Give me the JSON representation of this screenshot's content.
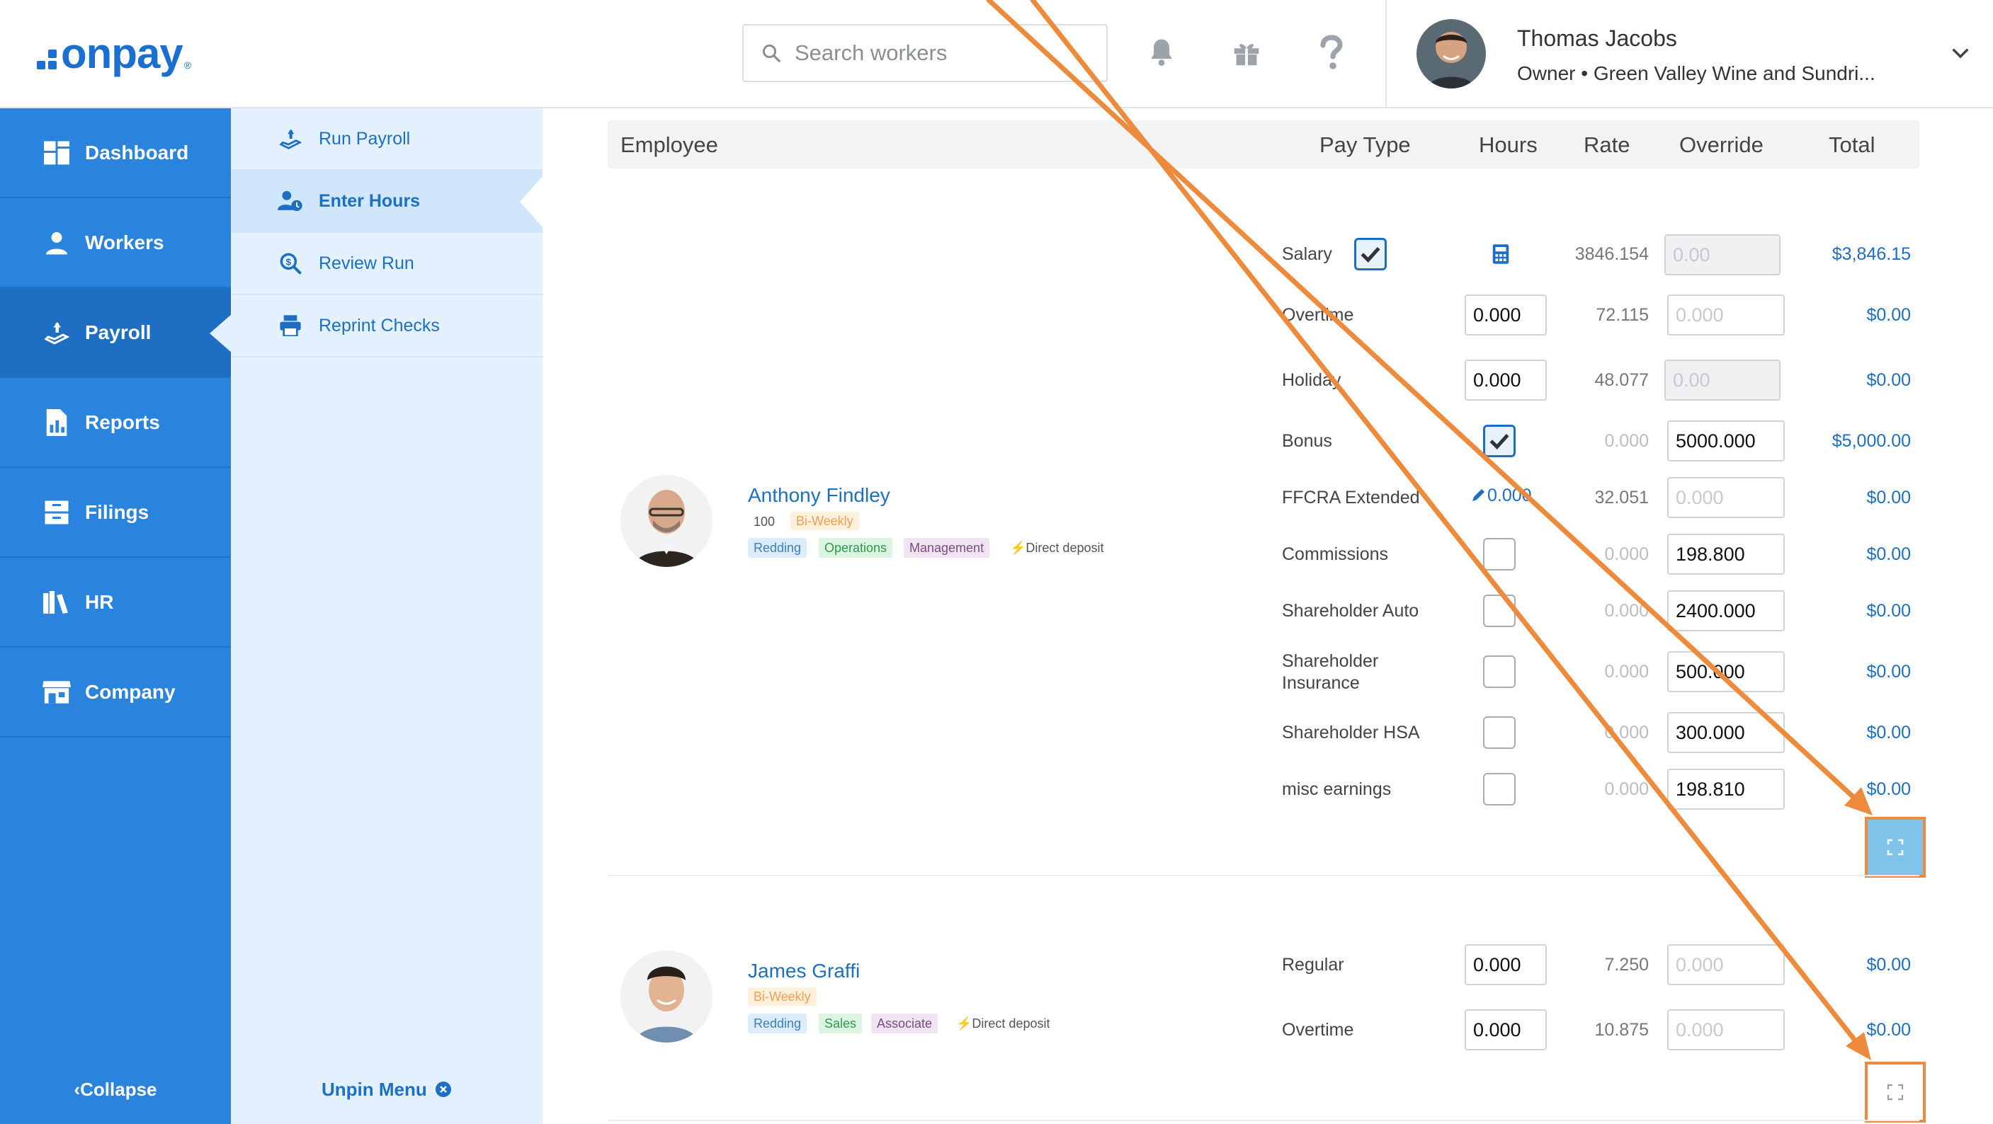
{
  "brand": {
    "logo_text": "onpay",
    "logo_mark": "®"
  },
  "header": {
    "search_placeholder": "Search workers",
    "icons": [
      "bell-icon",
      "gift-icon",
      "help-icon"
    ],
    "user_name": "Thomas Jacobs",
    "user_role": "Owner • Green Valley Wine and Sundri..."
  },
  "nav": {
    "items": [
      {
        "label": "Dashboard",
        "icon": "dashboard-icon"
      },
      {
        "label": "Workers",
        "icon": "workers-icon"
      },
      {
        "label": "Payroll",
        "icon": "payroll-icon"
      },
      {
        "label": "Reports",
        "icon": "reports-icon"
      },
      {
        "label": "Filings",
        "icon": "filings-icon"
      },
      {
        "label": "HR",
        "icon": "hr-icon"
      },
      {
        "label": "Company",
        "icon": "company-icon"
      }
    ],
    "collapse_label": "Collapse"
  },
  "subnav": {
    "items": [
      {
        "label": "Run Payroll",
        "icon": "run-payroll-icon"
      },
      {
        "label": "Enter Hours",
        "icon": "enter-hours-icon"
      },
      {
        "label": "Review Run",
        "icon": "review-run-icon"
      },
      {
        "label": "Reprint Checks",
        "icon": "printer-icon"
      }
    ],
    "unpin_label": "Unpin Menu"
  },
  "table": {
    "headers": {
      "employee": "Employee",
      "pay_type": "Pay Type",
      "hours": "Hours",
      "rate": "Rate",
      "override": "Override",
      "total": "Total"
    }
  },
  "employees": [
    {
      "name": "Anthony Findley",
      "id": "100",
      "frequency": "Bi-Weekly",
      "tags": [
        "Redding",
        "Operations",
        "Management"
      ],
      "deposit": "Direct deposit",
      "rows": {
        "salary": {
          "label": "Salary",
          "rate": "3846.154",
          "override": "0.00",
          "total": "$3,846.15"
        },
        "overtime": {
          "label": "Overtime",
          "hours": "0.000",
          "rate": "72.115",
          "override": "0.000",
          "total": "$0.00"
        },
        "holiday": {
          "label": "Holiday",
          "hours": "0.000",
          "rate": "48.077",
          "override": "0.00",
          "total": "$0.00"
        },
        "bonus": {
          "label": "Bonus",
          "rate": "0.000",
          "override": "5000.000",
          "total": "$5,000.00"
        },
        "ffcra": {
          "label": "FFCRA Extended",
          "hours": "0.000",
          "rate": "32.051",
          "override": "0.000",
          "total": "$0.00"
        },
        "commissions": {
          "label": "Commissions",
          "rate": "0.000",
          "override": "198.800",
          "total": "$0.00"
        },
        "sh_auto": {
          "label": "Shareholder Auto",
          "rate": "0.000",
          "override": "2400.000",
          "total": "$0.00"
        },
        "sh_ins": {
          "label1": "Shareholder",
          "label2": "Insurance",
          "rate": "0.000",
          "override": "500.000",
          "total": "$0.00"
        },
        "sh_hsa": {
          "label": "Shareholder HSA",
          "rate": "0.000",
          "override": "300.000",
          "total": "$0.00"
        },
        "misc": {
          "label": "misc earnings",
          "rate": "0.000",
          "override": "198.810",
          "total": "$0.00"
        }
      }
    },
    {
      "name": "James Graffi",
      "frequency": "Bi-Weekly",
      "tags": [
        "Redding",
        "Sales",
        "Associate"
      ],
      "deposit": "Direct deposit",
      "rows": {
        "regular": {
          "label": "Regular",
          "hours": "0.000",
          "rate": "7.250",
          "override": "0.000",
          "total": "$0.00"
        },
        "overtime": {
          "label": "Overtime",
          "hours": "0.000",
          "rate": "10.875",
          "override": "0.000",
          "total": "$0.00"
        }
      }
    }
  ],
  "colors": {
    "primary": "#2a83dc",
    "link": "#1d6fc4",
    "annotation": "#ee8a3c",
    "expand_active": "#7fc2ea"
  }
}
